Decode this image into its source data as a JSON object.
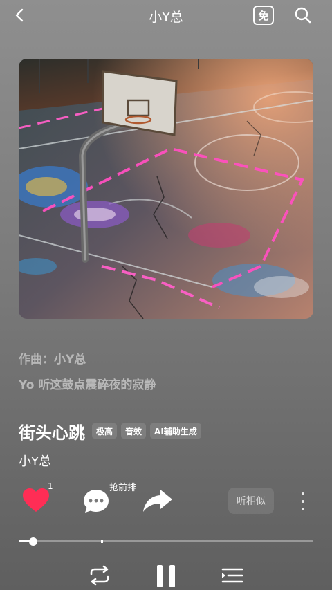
{
  "header": {
    "title": "小Y总",
    "free_label": "免",
    "back_icon": "back-arrow-icon",
    "search_icon": "search-icon"
  },
  "cover": {
    "description_icon": "album-cover-basketball-court"
  },
  "meta": {
    "composer": "作曲：小Y总",
    "lyric_line": "Yo 听这鼓点震碎夜的寂静"
  },
  "song": {
    "title": "街头心跳",
    "badges": [
      "极高",
      "音效",
      "AI辅助生成"
    ],
    "artist": "小Y总"
  },
  "actions": {
    "like_count": "1",
    "comment_label": "抢前排",
    "similar_label": "听相似",
    "like_color": "#ff2d55"
  },
  "player": {
    "progress": 0.05,
    "buffered_marker": 0.28
  },
  "controls": {
    "repeat_icon": "repeat-icon",
    "pause_icon": "pause-icon",
    "queue_icon": "playlist-icon"
  }
}
